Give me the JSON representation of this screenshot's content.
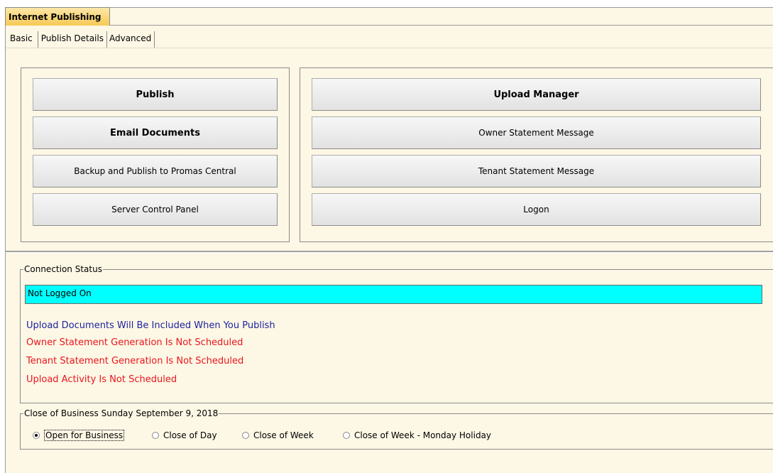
{
  "window": {
    "title": "Internet Publishing"
  },
  "tabs": [
    {
      "label": "Basic",
      "active": true
    },
    {
      "label": "Publish Details",
      "active": false
    },
    {
      "label": "Advanced",
      "active": false
    }
  ],
  "left_buttons": {
    "publish": "Publish",
    "email_documents": "Email Documents",
    "backup_publish": "Backup and Publish to Promas Central",
    "server_control_panel": "Server Control Panel"
  },
  "right_buttons": {
    "upload_manager": "Upload Manager",
    "owner_statement_message": "Owner Statement Message",
    "tenant_statement_message": "Tenant Statement Message",
    "logon": "Logon"
  },
  "connection_status": {
    "legend": "Connection Status",
    "status_text": "Not Logged On",
    "status_color": "#00ffff",
    "messages": [
      {
        "text": "Upload Documents Will Be Included When You Publish",
        "color": "#1e22a0"
      },
      {
        "text": "Owner Statement Generation Is Not Scheduled",
        "color": "#e8161e"
      },
      {
        "text": "Tenant Statement Generation Is Not Scheduled",
        "color": "#e8161e"
      },
      {
        "text": "Upload Activity Is Not Scheduled",
        "color": "#e8161e"
      }
    ]
  },
  "close_of_business": {
    "legend": "Close of Business Sunday September 9, 2018",
    "options": [
      {
        "label": "Open for Business",
        "selected": true
      },
      {
        "label": "Close of Day",
        "selected": false
      },
      {
        "label": "Close of Week",
        "selected": false
      },
      {
        "label": "Close of Week - Monday Holiday",
        "selected": false
      }
    ]
  }
}
